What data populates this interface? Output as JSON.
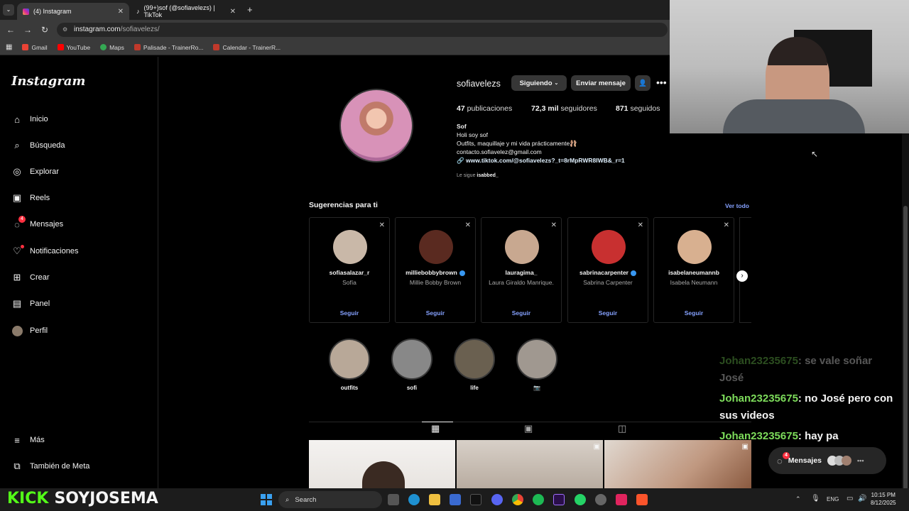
{
  "browser": {
    "tabs": [
      {
        "label": "(4) Instagram",
        "active": true
      },
      {
        "label": "(99+)sof (@sofiavelezs) | TikTok",
        "active": false
      }
    ],
    "url_host": "instagram.com",
    "url_path": "/sofiavelezs/",
    "bookmarks": [
      "Gmail",
      "YouTube",
      "Maps",
      "Palisade - TrainerRo...",
      "Calendar - TrainerR..."
    ]
  },
  "sidebar": {
    "logo": "Instagram",
    "items": [
      {
        "label": "Inicio",
        "icon": "home-icon"
      },
      {
        "label": "Búsqueda",
        "icon": "search-icon"
      },
      {
        "label": "Explorar",
        "icon": "compass-icon"
      },
      {
        "label": "Reels",
        "icon": "reels-icon"
      },
      {
        "label": "Mensajes",
        "icon": "messenger-icon",
        "badge": "4"
      },
      {
        "label": "Notificaciones",
        "icon": "heart-icon"
      },
      {
        "label": "Crear",
        "icon": "plus-square-icon"
      },
      {
        "label": "Panel",
        "icon": "chart-icon"
      },
      {
        "label": "Perfil",
        "icon": "profile-avatar-icon"
      }
    ],
    "more": "Más",
    "meta": "También de Meta"
  },
  "profile": {
    "username": "sofiavelezs",
    "following_btn": "Siguiendo",
    "message_btn": "Enviar mensaje",
    "posts_count": "47",
    "posts_label": "publicaciones",
    "followers_count": "72,3 mil",
    "followers_label": "seguidores",
    "following_count": "871",
    "following_label": "seguidos",
    "name": "Sof",
    "bio1": "Holi soy sof",
    "bio2": "Outfits, maquillaje y mi vida prácticamente🩰",
    "bio3": "contacto.sofiavelez@gmail.com",
    "link": "www.tiktok.com/@sofiavelezs?_t=8rMpRWR8IWB&_r=1",
    "followed_by_prefix": "Le sigue",
    "followed_by_user": "isabbed_"
  },
  "suggestions": {
    "title": "Sugerencias para ti",
    "see_all": "Ver todo",
    "follow_label": "Seguir",
    "cards": [
      {
        "username": "sofiasalazar_r",
        "name": "Sofía",
        "verified": false,
        "color": "#c9b8a8"
      },
      {
        "username": "milliebobbybrown",
        "name": "Millie Bobby Brown",
        "verified": true,
        "color": "#5a2a20"
      },
      {
        "username": "lauragima_",
        "name": "Laura Giraldo Manrique.",
        "verified": false,
        "color": "#c8a890"
      },
      {
        "username": "sabrinacarpenter",
        "name": "Sabrina Carpenter",
        "verified": true,
        "color": "#c83030"
      },
      {
        "username": "isabelaneumannb",
        "name": "Isabela Neumann",
        "verified": false,
        "color": "#d8b090"
      }
    ]
  },
  "highlights": [
    {
      "label": "outfits",
      "color": "#b8a898"
    },
    {
      "label": "sofi",
      "color": "#888888"
    },
    {
      "label": "life",
      "color": "#6a6050"
    },
    {
      "label": "📷",
      "color": "#a09890"
    }
  ],
  "chat": [
    {
      "user": "Johan23235675",
      "text": ": se vale soñar",
      "faded": true
    },
    {
      "user": "José",
      "text": "",
      "faded": true
    },
    {
      "user": "Johan23235675",
      "text": ": no José pero con",
      "faded": false
    },
    {
      "user": "",
      "text": "sus videos",
      "faded": false
    },
    {
      "user": "Johan23235675",
      "text": ": hay pa",
      "faded": false
    }
  ],
  "messages_pill": {
    "label": "Mensajes",
    "badge": "4"
  },
  "taskbar": {
    "stream_logo_a": "KICK",
    "stream_logo_b": "SOYJOSEMA",
    "search": "Search",
    "lang": "ENG",
    "time": "10:15 PM",
    "date": "8/12/2025"
  }
}
